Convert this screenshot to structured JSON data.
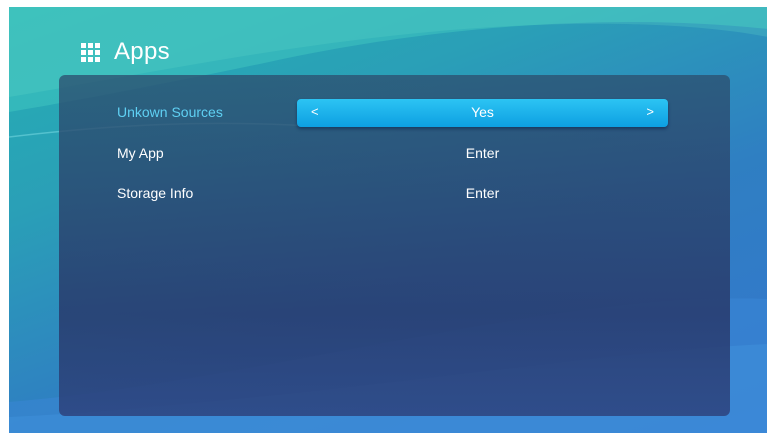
{
  "header": {
    "title": "Apps",
    "icon": "apps-grid-icon"
  },
  "settings": [
    {
      "label": "Unkown Sources",
      "value": "Yes",
      "selected": true,
      "prev_arrow": "<",
      "next_arrow": ">"
    },
    {
      "label": "My App",
      "value": "Enter",
      "selected": false
    },
    {
      "label": "Storage Info",
      "value": "Enter",
      "selected": false
    }
  ],
  "colors": {
    "selected_label": "#5fd0f3",
    "selector_fill": "#0d9fe2",
    "panel": "#2c3e6c",
    "background": "#2a9fb7"
  }
}
